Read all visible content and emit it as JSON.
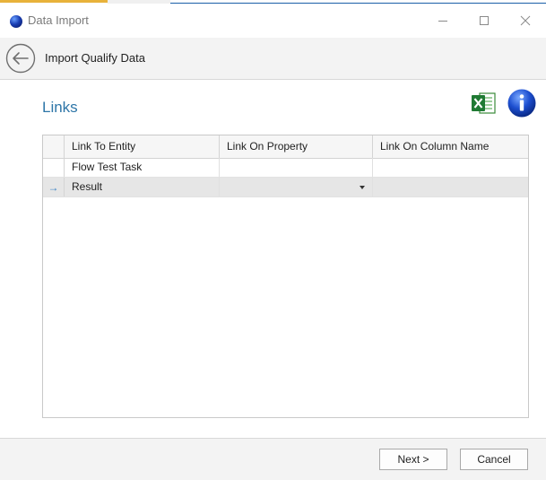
{
  "window": {
    "title": "Data Import"
  },
  "header": {
    "title": "Import Qualify Data"
  },
  "section": {
    "title": "Links"
  },
  "grid": {
    "columns": [
      "Link To Entity",
      "Link On Property",
      "Link On Column Name"
    ],
    "rows": [
      {
        "entity": "Flow Test Task",
        "property": "",
        "column": ""
      },
      {
        "entity": "Result",
        "property": "",
        "column": ""
      }
    ],
    "current_row_indicator": "→"
  },
  "footer": {
    "next_label": "Next >",
    "cancel_label": "Cancel"
  },
  "colors": {
    "accent": "#2e76a8",
    "title_text": "#7a7a7a",
    "selected_row": "#e6e6e6"
  },
  "icons": {
    "back": "back-arrow-icon",
    "excel": "excel-icon",
    "info": "info-icon",
    "app": "app-globe-icon"
  }
}
